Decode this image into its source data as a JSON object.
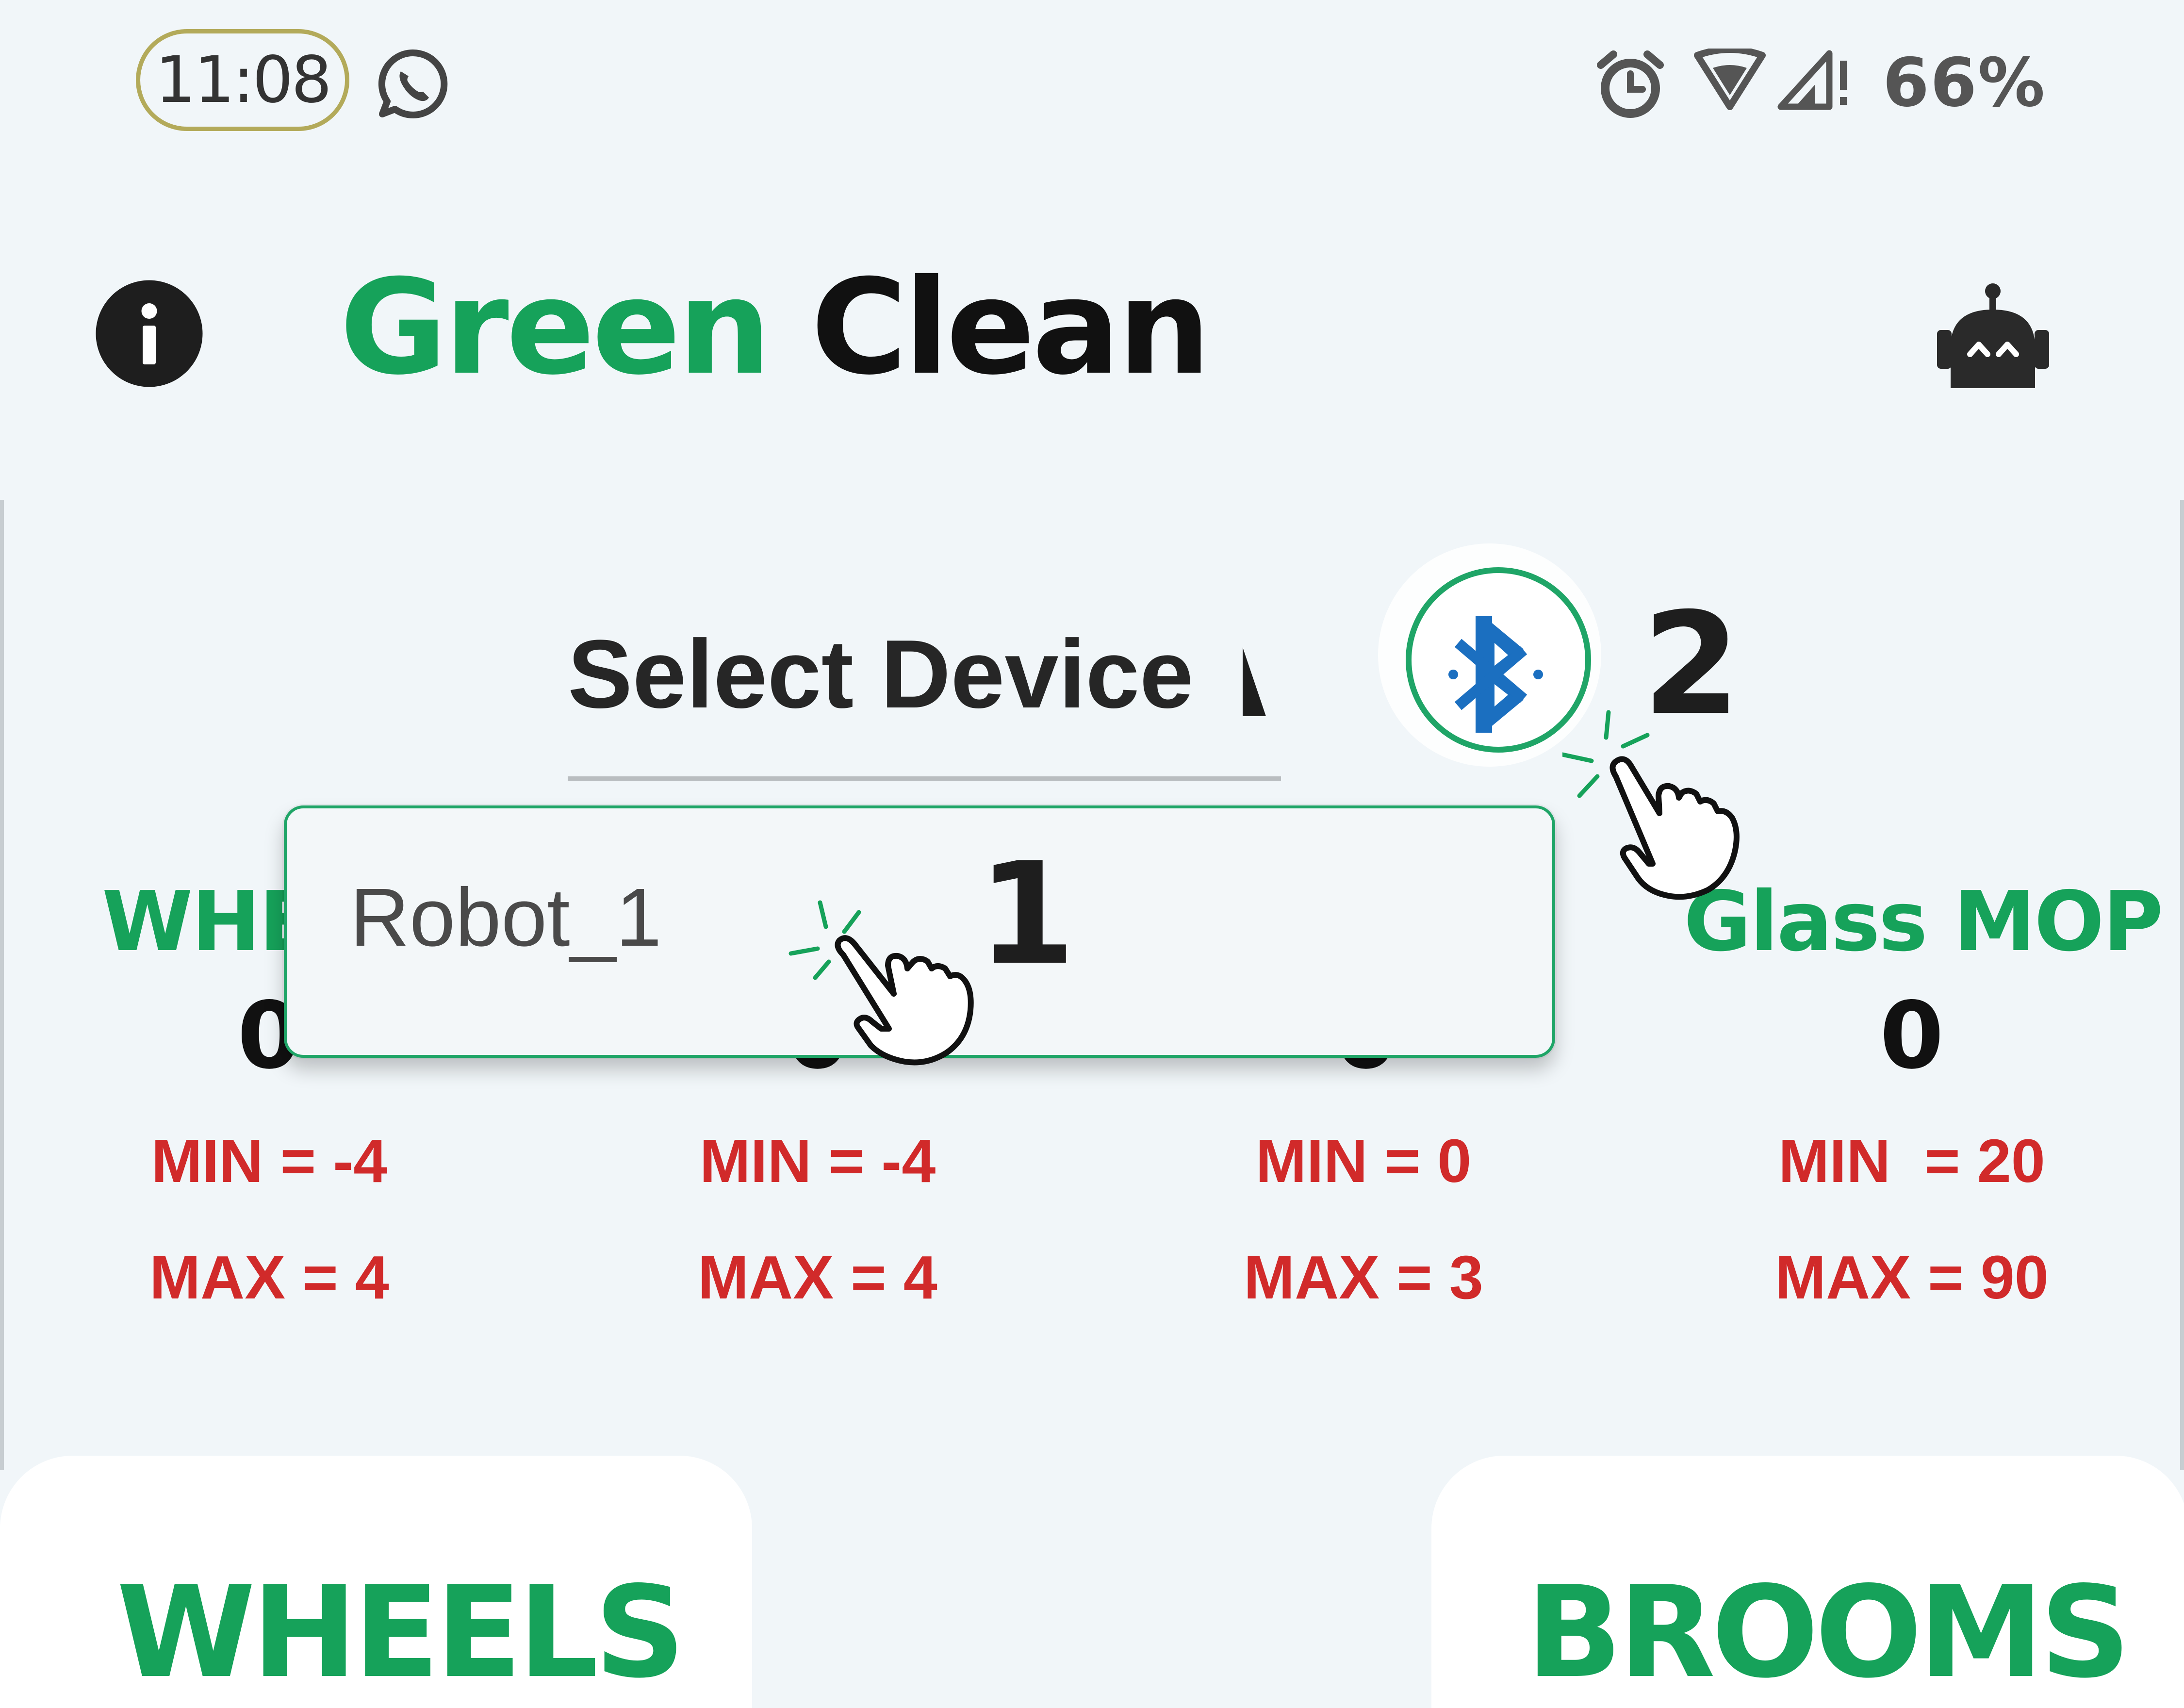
{
  "status_bar": {
    "time": "11:08",
    "battery": "66%",
    "icons": [
      "whatsapp-icon",
      "alarm-icon",
      "wifi-icon",
      "signal-icon"
    ]
  },
  "header": {
    "title_part1": "Green",
    "title_part2": "Clean",
    "info_icon": "info-icon",
    "robot_icon": "robot-icon"
  },
  "device_select": {
    "label": "Select Device",
    "options": [
      "Robot_1"
    ]
  },
  "callouts": {
    "step1": "1",
    "step2": "2"
  },
  "stats": [
    {
      "head": "WHE",
      "value": "0",
      "min": "MIN = -4",
      "max": "MAX = 4"
    },
    {
      "head": "",
      "value": "0",
      "min": "MIN = -4",
      "max": "MAX = 4"
    },
    {
      "head": "",
      "value": "0",
      "min": "MIN = 0",
      "max": "MAX = 3"
    },
    {
      "head": "Glass MOP",
      "value": "0",
      "min": "MIN  = 20",
      "max": "MAX = 90"
    }
  ],
  "bottom_cards": {
    "left": "WHEELS",
    "right": "BROOMS"
  },
  "colors": {
    "brand_green": "#16a25a",
    "alert_red": "#d12a2a",
    "bluetooth_blue": "#1b6fc0",
    "background": "#f1f6f9"
  }
}
